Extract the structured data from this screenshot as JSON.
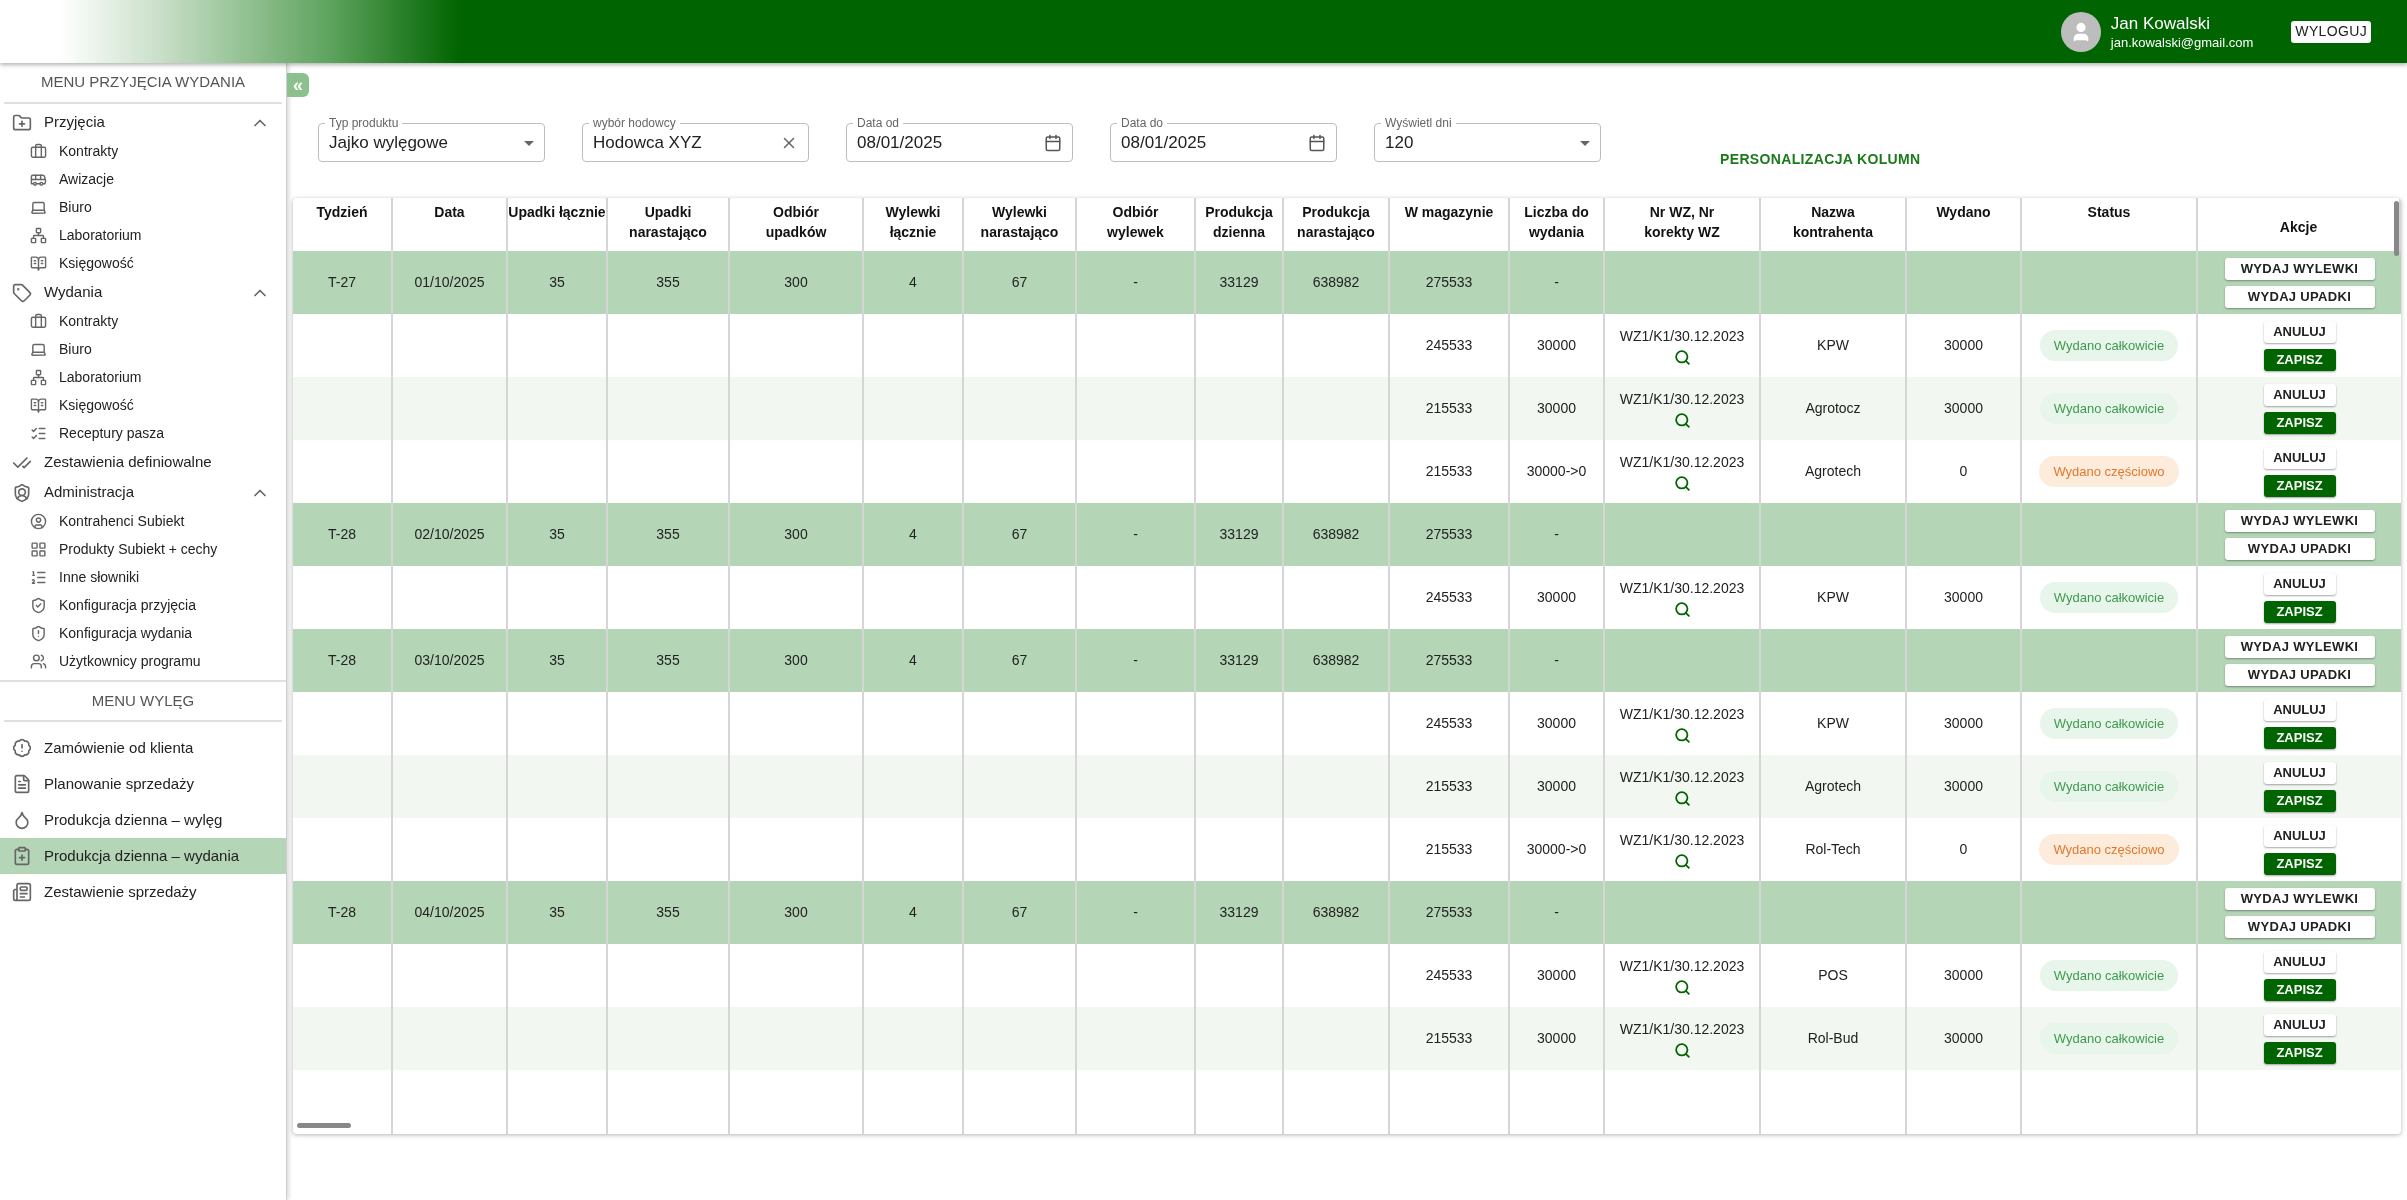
{
  "header": {
    "user_name": "Jan Kowalski",
    "user_email": "jan.kowalski@gmail.com",
    "logout": "WYLOGUJ"
  },
  "sidebar": {
    "collapse": "«",
    "menus": [
      {
        "title": "MENU PRZYJĘCIA WYDANIA",
        "items": [
          {
            "label": "Przyjęcia",
            "expanded": true,
            "selected": false,
            "children": [
              {
                "label": "Kontrakty",
                "selected": false
              },
              {
                "label": "Awizacje",
                "selected": false
              },
              {
                "label": "Biuro",
                "selected": false
              },
              {
                "label": "Laboratorium",
                "selected": false
              },
              {
                "label": "Księgowość",
                "selected": false
              }
            ]
          },
          {
            "label": "Wydania",
            "expanded": true,
            "selected": false,
            "children": [
              {
                "label": "Kontrakty",
                "selected": false
              },
              {
                "label": "Biuro",
                "selected": false
              },
              {
                "label": "Laboratorium",
                "selected": false
              },
              {
                "label": "Księgowość",
                "selected": false
              },
              {
                "label": "Receptury pasza",
                "selected": false
              }
            ]
          },
          {
            "label": "Zestawienia definiowalne",
            "selected": false
          },
          {
            "label": "Administracja",
            "expanded": true,
            "selected": false,
            "children": [
              {
                "label": "Kontrahenci Subiekt",
                "selected": false
              },
              {
                "label": "Produkty Subiekt + cechy",
                "selected": false
              },
              {
                "label": "Inne słowniki",
                "selected": false
              },
              {
                "label": "Konfiguracja przyjęcia",
                "selected": false
              },
              {
                "label": "Konfiguracja wydania",
                "selected": false
              },
              {
                "label": "Użytkownicy programu",
                "selected": false
              }
            ]
          }
        ]
      },
      {
        "title": "MENU WYLĘG",
        "items": [
          {
            "label": "Zamówienie od klienta",
            "selected": false
          },
          {
            "label": "Planowanie sprzedaży",
            "selected": false
          },
          {
            "label": "Produkcja dzienna – wylęg",
            "selected": false
          },
          {
            "label": "Produkcja dzienna – wydania",
            "selected": true
          },
          {
            "label": "Zestawienie sprzedaży",
            "selected": false
          }
        ]
      }
    ]
  },
  "filters": [
    {
      "kind": "select",
      "label": "Typ produktu",
      "value": "Jajko wylęgowe"
    },
    {
      "kind": "clearable",
      "label": "wybór hodowcy",
      "value": "Hodowca XYZ"
    },
    {
      "kind": "date",
      "label": "Data od",
      "value": "08/01/2025"
    },
    {
      "kind": "date",
      "label": "Data do",
      "value": "08/01/2025"
    },
    {
      "kind": "select",
      "label": "Wyświetl dni",
      "value": "120"
    }
  ],
  "personalize": "PERSONALIZACJA KOLUMN",
  "table": {
    "columns": [
      "Tydzień",
      "Data",
      "Upadki łącznie",
      "Upadki narastająco",
      "Odbiór upadków",
      "Wylewki łącznie",
      "Wylewki narastająco",
      "Odbiór wylewek",
      "Produkcja dzienna",
      "Produkcja narastająco",
      "W magazynie",
      "Liczba do wydania",
      "Nr WZ, Nr korekty WZ",
      "Nazwa kontrahenta",
      "Wydano",
      "Status",
      "Akcje"
    ],
    "groups": [
      {
        "cells": [
          "T-27",
          "01/10/2025",
          "35",
          "355",
          "300",
          "4",
          "67",
          "-",
          "33129",
          "638982",
          "275533",
          "-"
        ],
        "actions": [
          "WYDAJ WYLEWKI",
          "WYDAJ UPADKI"
        ],
        "details": [
          {
            "stock": "245533",
            "to_issue": "30000",
            "wz": "WZ1/K1/30.12.2023",
            "contractor": "KPW",
            "issued": "30000",
            "status": {
              "kind": "full",
              "label": "Wydano całkowicie"
            },
            "actions": [
              {
                "kind": "secondary",
                "label": "ANULUJ"
              },
              {
                "kind": "primary",
                "label": "ZAPISZ"
              }
            ]
          },
          {
            "stock": "215533",
            "to_issue": "30000",
            "wz": "WZ1/K1/30.12.2023",
            "contractor": "Agrotocz",
            "issued": "30000",
            "status": {
              "kind": "full",
              "label": "Wydano całkowicie"
            },
            "actions": [
              {
                "kind": "secondary",
                "label": "ANULUJ"
              },
              {
                "kind": "primary",
                "label": "ZAPISZ"
              }
            ]
          },
          {
            "stock": "215533",
            "to_issue": "30000->0",
            "wz": "WZ1/K1/30.12.2023",
            "contractor": "Agrotech",
            "issued": "0",
            "status": {
              "kind": "partial",
              "label": "Wydano częściowo"
            },
            "actions": [
              {
                "kind": "secondary",
                "label": "ANULUJ"
              },
              {
                "kind": "primary",
                "label": "ZAPISZ"
              }
            ]
          }
        ]
      },
      {
        "cells": [
          "T-28",
          "02/10/2025",
          "35",
          "355",
          "300",
          "4",
          "67",
          "-",
          "33129",
          "638982",
          "275533",
          "-"
        ],
        "actions": [
          "WYDAJ WYLEWKI",
          "WYDAJ UPADKI"
        ],
        "details": [
          {
            "stock": "245533",
            "to_issue": "30000",
            "wz": "WZ1/K1/30.12.2023",
            "contractor": "KPW",
            "issued": "30000",
            "status": {
              "kind": "full",
              "label": "Wydano całkowicie"
            },
            "actions": [
              {
                "kind": "secondary",
                "label": "ANULUJ"
              },
              {
                "kind": "primary",
                "label": "ZAPISZ"
              }
            ]
          }
        ]
      },
      {
        "cells": [
          "T-28",
          "03/10/2025",
          "35",
          "355",
          "300",
          "4",
          "67",
          "-",
          "33129",
          "638982",
          "275533",
          "-"
        ],
        "actions": [
          "WYDAJ WYLEWKI",
          "WYDAJ UPADKI"
        ],
        "details": [
          {
            "stock": "245533",
            "to_issue": "30000",
            "wz": "WZ1/K1/30.12.2023",
            "contractor": "KPW",
            "issued": "30000",
            "status": {
              "kind": "full",
              "label": "Wydano całkowicie"
            },
            "actions": [
              {
                "kind": "secondary",
                "label": "ANULUJ"
              },
              {
                "kind": "primary",
                "label": "ZAPISZ"
              }
            ]
          },
          {
            "stock": "215533",
            "to_issue": "30000",
            "wz": "WZ1/K1/30.12.2023",
            "contractor": "Agrotech",
            "issued": "30000",
            "status": {
              "kind": "full",
              "label": "Wydano całkowicie"
            },
            "actions": [
              {
                "kind": "secondary",
                "label": "ANULUJ"
              },
              {
                "kind": "primary",
                "label": "ZAPISZ"
              }
            ]
          },
          {
            "stock": "215533",
            "to_issue": "30000->0",
            "wz": "WZ1/K1/30.12.2023",
            "contractor": "Rol-Tech",
            "issued": "0",
            "status": {
              "kind": "partial",
              "label": "Wydano częściowo"
            },
            "actions": [
              {
                "kind": "secondary",
                "label": "ANULUJ"
              },
              {
                "kind": "primary",
                "label": "ZAPISZ"
              }
            ]
          }
        ]
      },
      {
        "cells": [
          "T-28",
          "04/10/2025",
          "35",
          "355",
          "300",
          "4",
          "67",
          "-",
          "33129",
          "638982",
          "275533",
          "-"
        ],
        "actions": [
          "WYDAJ WYLEWKI",
          "WYDAJ UPADKI"
        ],
        "details": [
          {
            "stock": "245533",
            "to_issue": "30000",
            "wz": "WZ1/K1/30.12.2023",
            "contractor": "POS",
            "issued": "30000",
            "status": {
              "kind": "full",
              "label": "Wydano całkowicie"
            },
            "actions": [
              {
                "kind": "secondary",
                "label": "ANULUJ"
              },
              {
                "kind": "primary",
                "label": "ZAPISZ"
              }
            ]
          },
          {
            "stock": "215533",
            "to_issue": "30000",
            "wz": "WZ1/K1/30.12.2023",
            "contractor": "Rol-Bud",
            "issued": "30000",
            "status": {
              "kind": "full",
              "label": "Wydano całkowicie"
            },
            "actions": [
              {
                "kind": "secondary",
                "label": "ANULUJ"
              },
              {
                "kind": "primary",
                "label": "ZAPISZ"
              }
            ]
          }
        ]
      }
    ]
  }
}
